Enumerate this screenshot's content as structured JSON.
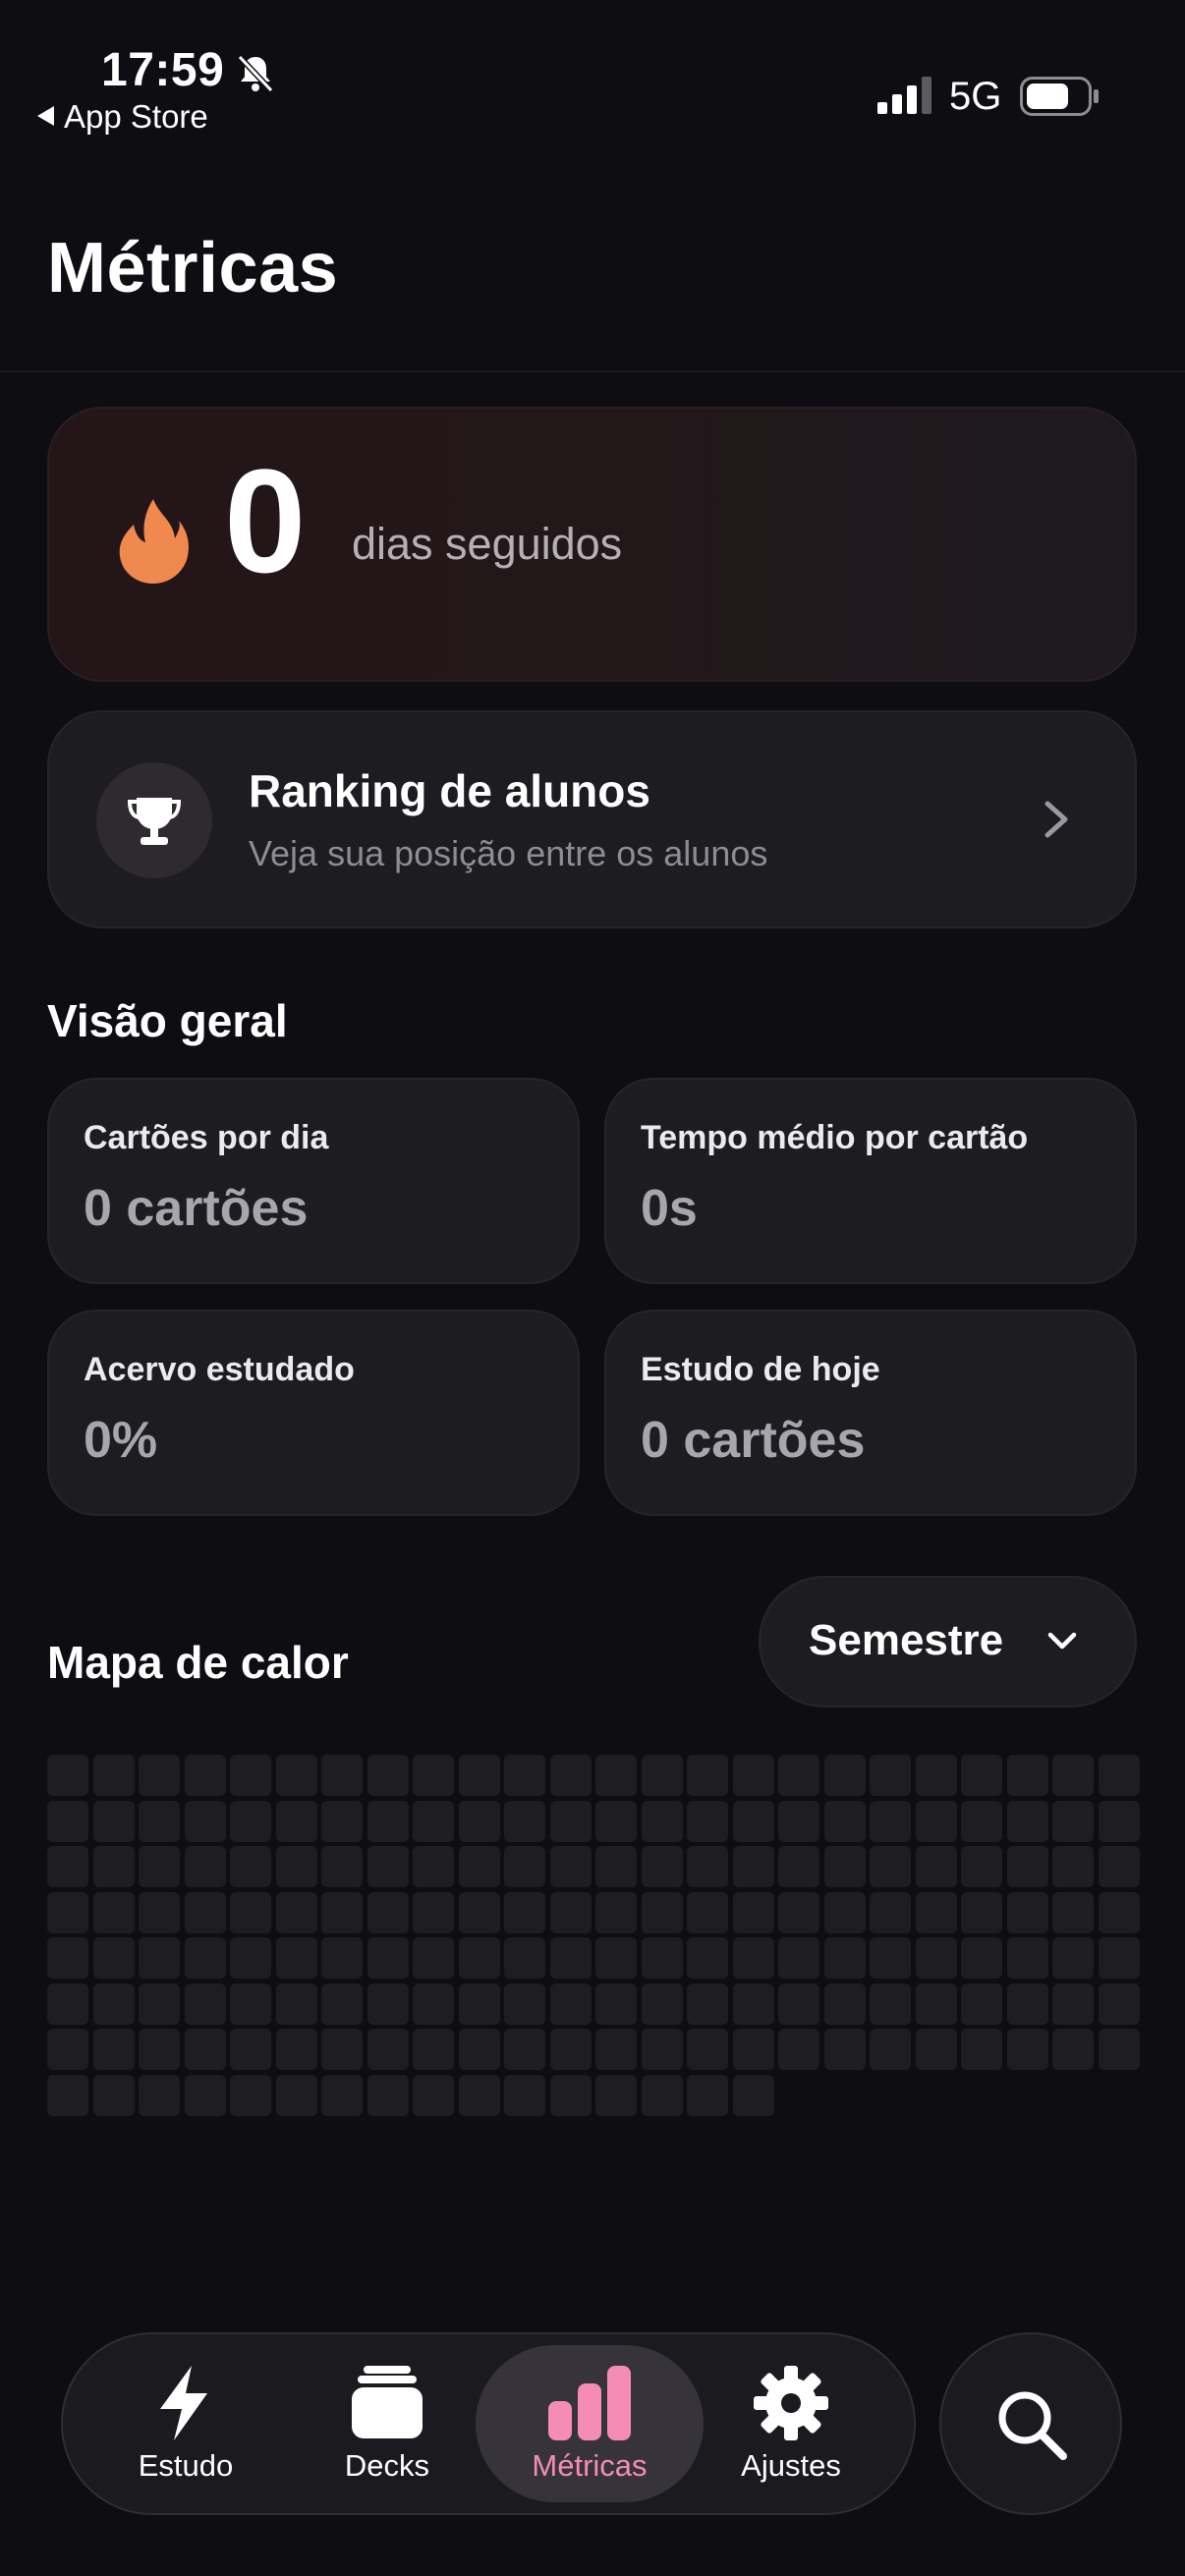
{
  "status_bar": {
    "time": "17:59",
    "back_app": "App Store",
    "network": "5G"
  },
  "header": {
    "title": "Métricas"
  },
  "streak": {
    "count": "0",
    "label": "dias seguidos",
    "accent": "#f0894d"
  },
  "ranking": {
    "title": "Ranking de alunos",
    "subtitle": "Veja sua posição entre os alunos"
  },
  "overview": {
    "title": "Visão geral",
    "stats": [
      {
        "label": "Cartões por dia",
        "value": "0 cartões"
      },
      {
        "label": "Tempo médio por cartão",
        "value": "0s"
      },
      {
        "label": "Acervo estudado",
        "value": "0%"
      },
      {
        "label": "Estudo de hoje",
        "value": "0 cartões"
      }
    ]
  },
  "heatmap": {
    "title": "Mapa de calor",
    "period": "Semestre",
    "full_columns": 24,
    "rows": 8,
    "last_row_cells": 16,
    "empty_color": "#1d1d22"
  },
  "tabbar": {
    "active_color": "#f48cb5",
    "tabs": [
      {
        "label": "Estudo",
        "icon": "lightning-icon"
      },
      {
        "label": "Decks",
        "icon": "stack-icon"
      },
      {
        "label": "Métricas",
        "icon": "bar-chart-icon",
        "active": true
      },
      {
        "label": "Ajustes",
        "icon": "gear-icon"
      }
    ],
    "search_icon": "search-icon"
  }
}
